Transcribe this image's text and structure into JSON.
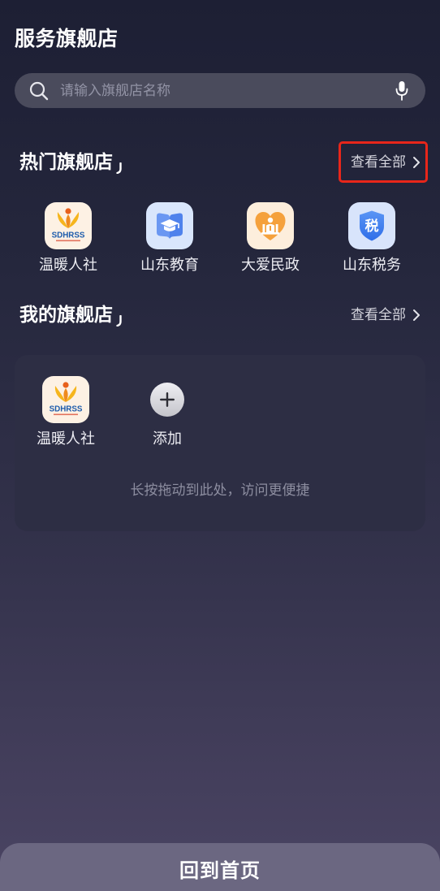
{
  "header": {
    "title": "服务旗舰店"
  },
  "search": {
    "placeholder": "请输入旗舰店名称",
    "search_icon": "search-icon",
    "voice_icon": "microphone-icon"
  },
  "hot_section": {
    "title": "热门旗舰店",
    "view_all": "查看全部",
    "view_all_icon": "chevron-right-icon",
    "items": [
      {
        "label": "温暖人社",
        "icon": "sdhrss-logo-icon",
        "logo_text": "SDHRSS"
      },
      {
        "label": "山东教育",
        "icon": "education-book-icon"
      },
      {
        "label": "大爱民政",
        "icon": "civil-affairs-heart-icon"
      },
      {
        "label": "山东税务",
        "icon": "tax-shield-icon",
        "logo_text": "税"
      }
    ]
  },
  "my_section": {
    "title": "我的旗舰店",
    "view_all": "查看全部",
    "view_all_icon": "chevron-right-icon",
    "items": [
      {
        "label": "温暖人社",
        "icon": "sdhrss-logo-icon",
        "logo_text": "SDHRSS"
      }
    ],
    "add": {
      "label": "添加",
      "icon": "plus-icon"
    },
    "hint": "长按拖动到此处，访问更便捷"
  },
  "footer": {
    "home_button": "回到首页"
  },
  "colors": {
    "background_top": "#1d1f34",
    "background_bottom": "#4a4463",
    "search_bg": "#4a4b5c",
    "card_bg": "#2d2e44",
    "text_primary": "#ffffff",
    "text_secondary": "#d4d4dd",
    "placeholder": "#9293a5",
    "hint": "#8d8ea0",
    "footer_bg": "#6b6781",
    "highlight_box": "#e8261a"
  }
}
